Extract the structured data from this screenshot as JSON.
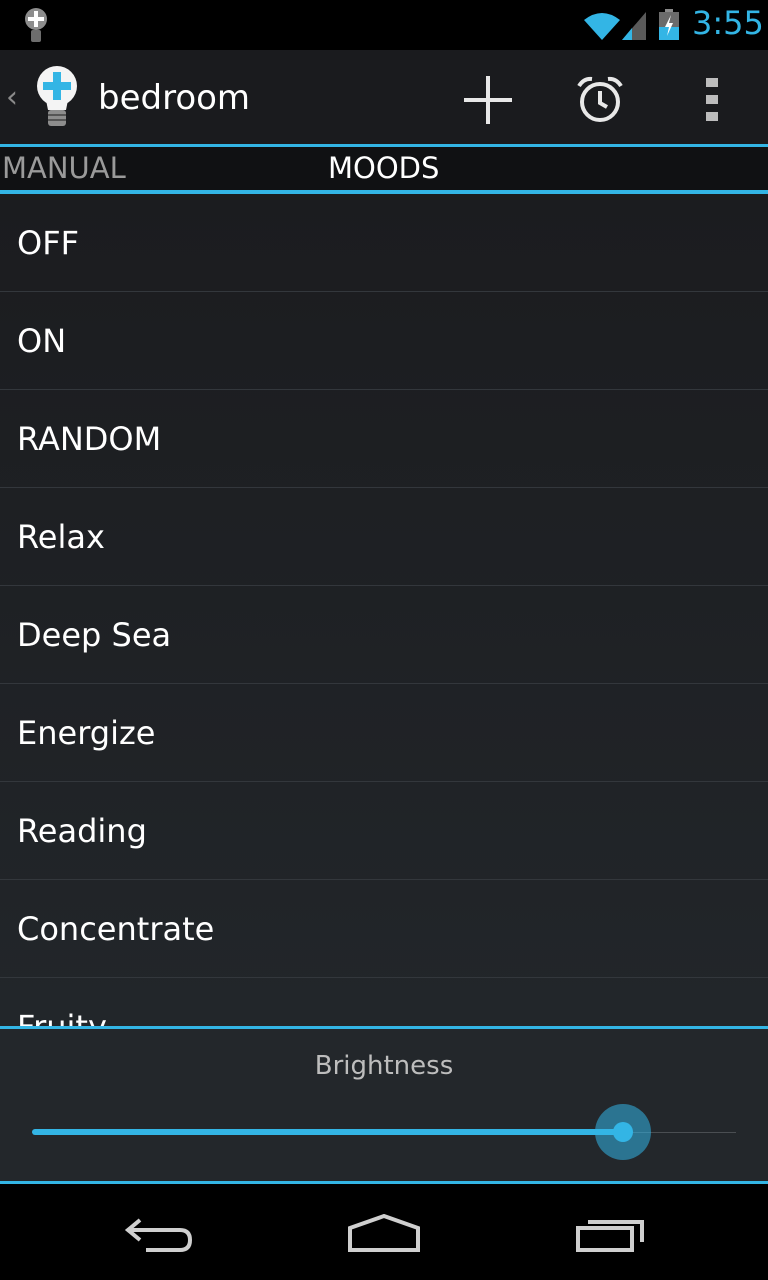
{
  "status_bar": {
    "time": "3:55",
    "icons": [
      "lightbulb-notification-icon",
      "wifi-icon",
      "cell-signal-icon",
      "battery-charging-icon"
    ]
  },
  "action_bar": {
    "title": "bedroom",
    "up_caret": "‹",
    "actions": [
      "add-icon",
      "alarm-icon",
      "overflow-menu-icon"
    ]
  },
  "tabs": [
    {
      "label": "MANUAL",
      "selected": false
    },
    {
      "label": "MOODS",
      "selected": true
    }
  ],
  "moods": [
    {
      "label": "OFF"
    },
    {
      "label": "ON"
    },
    {
      "label": "RANDOM"
    },
    {
      "label": "Relax"
    },
    {
      "label": "Deep Sea"
    },
    {
      "label": "Energize"
    },
    {
      "label": "Reading"
    },
    {
      "label": "Concentrate"
    },
    {
      "label": "Fruity"
    }
  ],
  "brightness": {
    "label": "Brightness",
    "value_fraction": 0.84
  },
  "colors": {
    "accent": "#33b5e5",
    "background": "#1b1d20"
  },
  "nav_bar": {
    "icons": [
      "back-icon",
      "home-icon",
      "recent-apps-icon"
    ]
  }
}
